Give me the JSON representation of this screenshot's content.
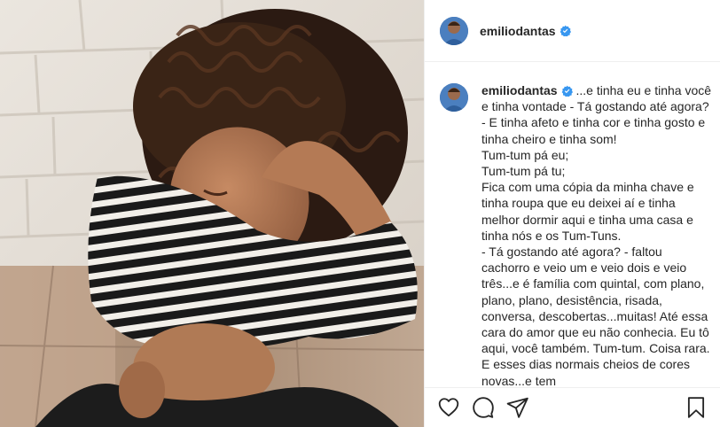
{
  "post": {
    "username": "emiliodantas",
    "verified": true,
    "caption_author": "emiliodantas",
    "caption": " ...e tinha eu e tinha você e tinha vontade - Tá gostando até agora? - E tinha afeto e tinha cor e tinha gosto e tinha cheiro e tinha som!\nTum-tum pá eu;\nTum-tum pá tu;\nFica com uma cópia da minha chave e tinha roupa que eu deixei aí e tinha melhor dormir aqui e tinha uma casa e tinha nós e os Tum-Tuns.\n- Tá gostando até agora? - faltou cachorro e veio um e veio dois e veio três...e é família com quintal, com plano, plano, plano, desistência, risada, conversa, descobertas...muitas! Até essa cara do amor que eu não conhecia. Eu tô aqui, você também. Tum-tum. Coisa rara. E esses dias normais cheios de cores novas...e tem"
  },
  "icons": {
    "verified": "verified-badge-icon",
    "like": "heart-icon",
    "comment": "comment-icon",
    "share": "paper-plane-icon",
    "save": "bookmark-icon"
  },
  "colors": {
    "verified": "#3897f0",
    "text": "#262626",
    "border": "#efefef"
  }
}
